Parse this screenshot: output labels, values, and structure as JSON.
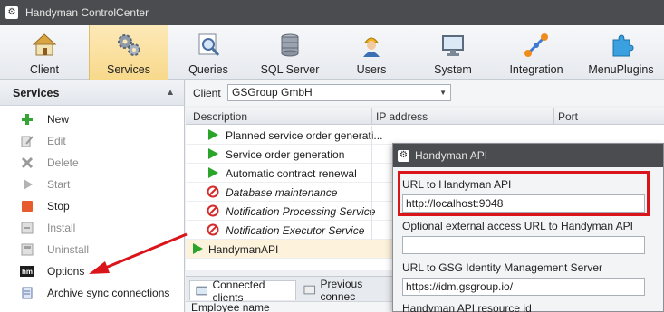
{
  "window": {
    "title": "Handyman ControlCenter"
  },
  "ribbon": {
    "tabs": [
      {
        "label": "Client",
        "icon": "house-icon"
      },
      {
        "label": "Services",
        "icon": "gears-icon",
        "active": true
      },
      {
        "label": "Queries",
        "icon": "query-magnifier-icon"
      },
      {
        "label": "SQL Server",
        "icon": "database-icon"
      },
      {
        "label": "Users",
        "icon": "user-hardhat-icon"
      },
      {
        "label": "System",
        "icon": "computer-icon"
      },
      {
        "label": "Integration",
        "icon": "integration-icon"
      },
      {
        "label": "MenuPlugins",
        "icon": "puzzle-icon"
      }
    ]
  },
  "services_panel": {
    "title": "Services",
    "items": [
      {
        "label": "New",
        "icon": "plus-icon",
        "enabled": true
      },
      {
        "label": "Edit",
        "icon": "edit-icon",
        "enabled": false
      },
      {
        "label": "Delete",
        "icon": "delete-x-icon",
        "enabled": false
      },
      {
        "label": "Start",
        "icon": "play-icon",
        "enabled": false
      },
      {
        "label": "Stop",
        "icon": "stop-icon",
        "enabled": true
      },
      {
        "label": "Install",
        "icon": "install-icon",
        "enabled": false
      },
      {
        "label": "Uninstall",
        "icon": "uninstall-icon",
        "enabled": false
      },
      {
        "label": "Options",
        "icon": "hm-options-icon",
        "enabled": true
      },
      {
        "label": "Archive sync connections",
        "icon": "archive-icon",
        "enabled": true
      }
    ]
  },
  "client_bar": {
    "label": "Client",
    "value": "GSGroup GmbH"
  },
  "grid": {
    "columns": [
      "Description",
      "IP address",
      "Port"
    ],
    "rows": [
      {
        "name": "Planned service order generati...",
        "status": "running",
        "italic": false
      },
      {
        "name": "Service order generation",
        "status": "running",
        "italic": false
      },
      {
        "name": "Automatic contract renewal",
        "status": "running",
        "italic": false
      },
      {
        "name": "Database maintenance",
        "status": "stopped",
        "italic": true
      },
      {
        "name": "Notification Processing Service",
        "status": "stopped",
        "italic": true
      },
      {
        "name": "Notification Executor Service",
        "status": "stopped",
        "italic": true
      },
      {
        "name": "HandymanAPI",
        "status": "running",
        "italic": false,
        "selected": true
      }
    ]
  },
  "bottom": {
    "tabs": [
      "Connected clients",
      "Previous connec"
    ],
    "column": "Employee name"
  },
  "dialog": {
    "title": "Handyman API",
    "fields": [
      {
        "label": "URL to Handyman API",
        "value": "http://localhost:9048"
      },
      {
        "label": "Optional external access URL to Handyman API",
        "value": ""
      },
      {
        "label": "URL to GSG Identity Management Server",
        "value": "https://idm.gsgroup.io/"
      },
      {
        "label": "Handyman API resource id",
        "value": ""
      }
    ]
  },
  "colors": {
    "highlight": "#d9141a",
    "running": "#2aa52a",
    "stopped": "#d62b2b",
    "ribbon_active": "#f8d98b"
  }
}
